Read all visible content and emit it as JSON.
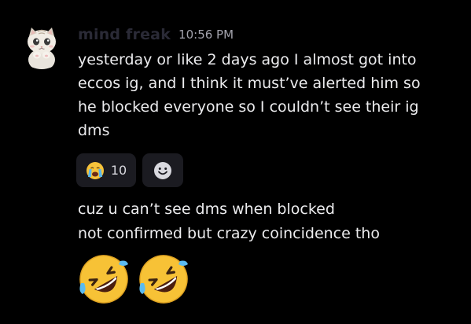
{
  "message": {
    "username": "mind freak",
    "timestamp": "10:56 PM",
    "lines": [
      "yesterday or like 2 days ago I almost got into",
      "eccos ig, and I think it must’ve alerted him so",
      "he blocked everyone so I couldn’t see their ig",
      "dms"
    ],
    "reactions": [
      {
        "icon": "crying-face-emoji",
        "count": "10"
      },
      {
        "icon": "add-reaction-smiley-icon"
      }
    ],
    "followups": [
      "cuz u can’t see dms when blocked",
      "not confirmed but crazy coincidence tho"
    ],
    "big_emojis": [
      "rolling-on-floor-laughing-emoji",
      "rolling-on-floor-laughing-emoji"
    ]
  },
  "colors": {
    "background": "#000000",
    "text": "#ececee",
    "timestamp": "#a3a3ad",
    "reaction_bg": "#1b1b21",
    "username": "#2a2a36"
  }
}
